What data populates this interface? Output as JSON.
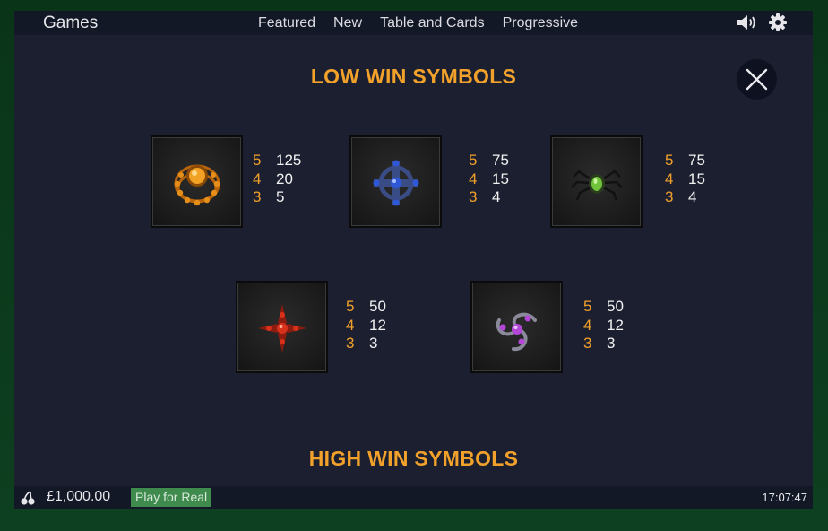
{
  "topbar": {
    "brand": "Games",
    "nav": [
      "Featured",
      "New",
      "Table and Cards",
      "Progressive"
    ],
    "icons": [
      "speaker-icon",
      "gear-icon"
    ]
  },
  "paytable": {
    "low_title": "LOW WIN SYMBOLS",
    "high_title": "HIGH WIN SYMBOLS",
    "close_icon": "close-icon",
    "symbols": [
      {
        "icon": "amber-brooch-symbol",
        "accent": "#e0880f",
        "pays": [
          {
            "count": "5",
            "value": "125"
          },
          {
            "count": "4",
            "value": "20"
          },
          {
            "count": "3",
            "value": "5"
          }
        ]
      },
      {
        "icon": "blue-cross-symbol",
        "accent": "#2f58d8",
        "pays": [
          {
            "count": "5",
            "value": "75"
          },
          {
            "count": "4",
            "value": "15"
          },
          {
            "count": "3",
            "value": "4"
          }
        ]
      },
      {
        "icon": "green-spider-symbol",
        "accent": "#6fc23a",
        "pays": [
          {
            "count": "5",
            "value": "75"
          },
          {
            "count": "4",
            "value": "15"
          },
          {
            "count": "3",
            "value": "4"
          }
        ]
      },
      {
        "icon": "red-star-symbol",
        "accent": "#d8311b",
        "pays": [
          {
            "count": "5",
            "value": "50"
          },
          {
            "count": "4",
            "value": "12"
          },
          {
            "count": "3",
            "value": "3"
          }
        ]
      },
      {
        "icon": "purple-triskele-symbol",
        "accent": "#b447d8",
        "pays": [
          {
            "count": "5",
            "value": "50"
          },
          {
            "count": "4",
            "value": "12"
          },
          {
            "count": "3",
            "value": "3"
          }
        ]
      }
    ]
  },
  "bottombar": {
    "balance_icon": "cherries-icon",
    "balance": "£1,000.00",
    "play_for_real": "Play for Real",
    "clock": "17:07:47"
  },
  "colors": {
    "accent": "#f2a12a",
    "frame": "#0c3a1c",
    "panel": "#1c1f30",
    "bar": "#131826",
    "play_button": "#3f8b4e"
  }
}
